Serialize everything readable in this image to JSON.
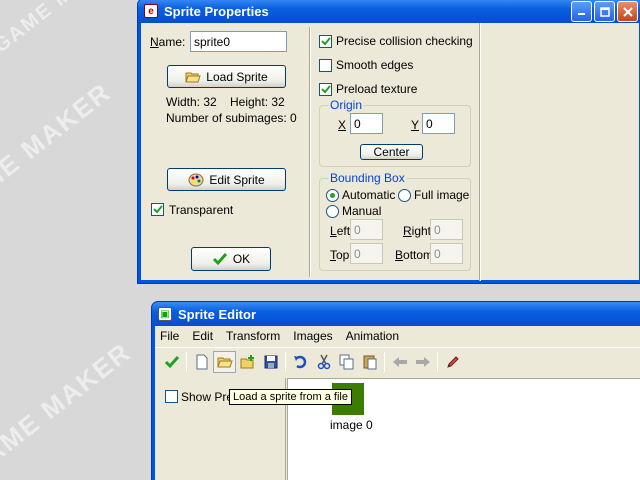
{
  "watermark": {
    "text": "GAME MAKER"
  },
  "sprite_properties": {
    "title": "Sprite Properties",
    "name_label": "Name:",
    "name_value": "sprite0",
    "load_sprite_label": "Load Sprite",
    "width_text": "Width: 32",
    "height_text": "Height: 32",
    "subimages_text": "Number of subimages: 0",
    "edit_sprite_label": "Edit Sprite",
    "transparent_label": "Transparent",
    "transparent_checked": true,
    "ok_label": "OK",
    "precise_collision_label": "Precise collision checking",
    "precise_collision_checked": true,
    "smooth_edges_label": "Smooth edges",
    "smooth_edges_checked": false,
    "preload_texture_label": "Preload texture",
    "preload_texture_checked": true,
    "origin": {
      "title": "Origin",
      "x_label": "X",
      "x_value": "0",
      "y_label": "Y",
      "y_value": "0",
      "center_label": "Center"
    },
    "bounding_box": {
      "title": "Bounding Box",
      "automatic_label": "Automatic",
      "full_image_label": "Full image",
      "manual_label": "Manual",
      "selected": "automatic",
      "left_label": "Left",
      "left_value": "0",
      "right_label": "Right",
      "right_value": "0",
      "top_label": "Top",
      "top_value": "0",
      "bottom_label": "Bottom",
      "bottom_value": "0"
    }
  },
  "sprite_editor": {
    "title": "Sprite Editor",
    "menu": [
      "File",
      "Edit",
      "Transform",
      "Images",
      "Animation"
    ],
    "show_preview_label": "Show Pre",
    "tooltip": "Load a sprite from a file",
    "image_label": "image 0",
    "image_color": "#3a7d00"
  },
  "colors": {
    "titlebar": "#0054e3",
    "client": "#ece9d8",
    "check_green": "#21a121"
  }
}
